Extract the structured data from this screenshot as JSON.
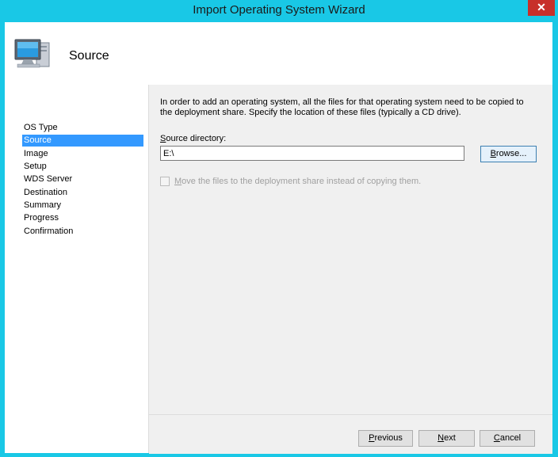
{
  "window": {
    "title": "Import Operating System Wizard",
    "close_glyph": "✕"
  },
  "header": {
    "title": "Source",
    "icon": "computer-icon"
  },
  "sidebar": {
    "items": [
      {
        "label": "OS Type",
        "active": false
      },
      {
        "label": "Source",
        "active": true
      },
      {
        "label": "Image",
        "active": false
      },
      {
        "label": "Setup",
        "active": false
      },
      {
        "label": "WDS Server",
        "active": false
      },
      {
        "label": "Destination",
        "active": false
      },
      {
        "label": "Summary",
        "active": false
      },
      {
        "label": "Progress",
        "active": false
      },
      {
        "label": "Confirmation",
        "active": false
      }
    ]
  },
  "main": {
    "intro": "In order to add an operating system, all the files for that operating system need to be copied to the deployment share.  Specify the location of these files (typically a CD drive).",
    "source_label_first": "S",
    "source_label_rest": "ource directory:",
    "source_value": "E:\\",
    "browse_first": "B",
    "browse_rest": "rowse...",
    "move_checkbox": {
      "label_first": "M",
      "label_rest": "ove the files to the deployment share instead of copying them.",
      "checked": false,
      "enabled": false
    }
  },
  "footer": {
    "previous_first": "P",
    "previous_rest": "revious",
    "next_first": "N",
    "next_rest": "ext",
    "cancel_first": "C",
    "cancel_rest": "ancel"
  },
  "colors": {
    "titlebar": "#19c8e6",
    "selection": "#3399ff",
    "close": "#c7302a",
    "panel": "#f0f0f0"
  }
}
